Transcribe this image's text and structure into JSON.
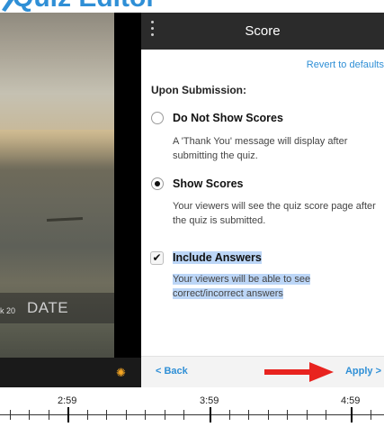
{
  "page_title": "Quiz Editor",
  "video": {
    "lower_third_small": "k 20",
    "lower_third_date": "DATE"
  },
  "panel": {
    "title": "Score",
    "revert_label": "Revert to defaults",
    "section_heading": "Upon Submission:",
    "options": [
      {
        "label": "Do Not Show Scores",
        "description": "A 'Thank You' message will display after submitting the quiz.",
        "selected": false
      },
      {
        "label": "Show Scores",
        "description": "Your viewers will see the quiz score page after the quiz is submitted.",
        "selected": true
      }
    ],
    "include_answers": {
      "label": "Include Answers",
      "description": "Your viewers will be able to see correct/incorrect answers",
      "checked": true
    },
    "footer": {
      "back_label": "< Back",
      "apply_label": "Apply >"
    },
    "arrow_color": "#e8231f",
    "accent_color": "#2f8fd6"
  },
  "timeline": {
    "labels": [
      "2:59",
      "3:59",
      "4:59"
    ]
  }
}
